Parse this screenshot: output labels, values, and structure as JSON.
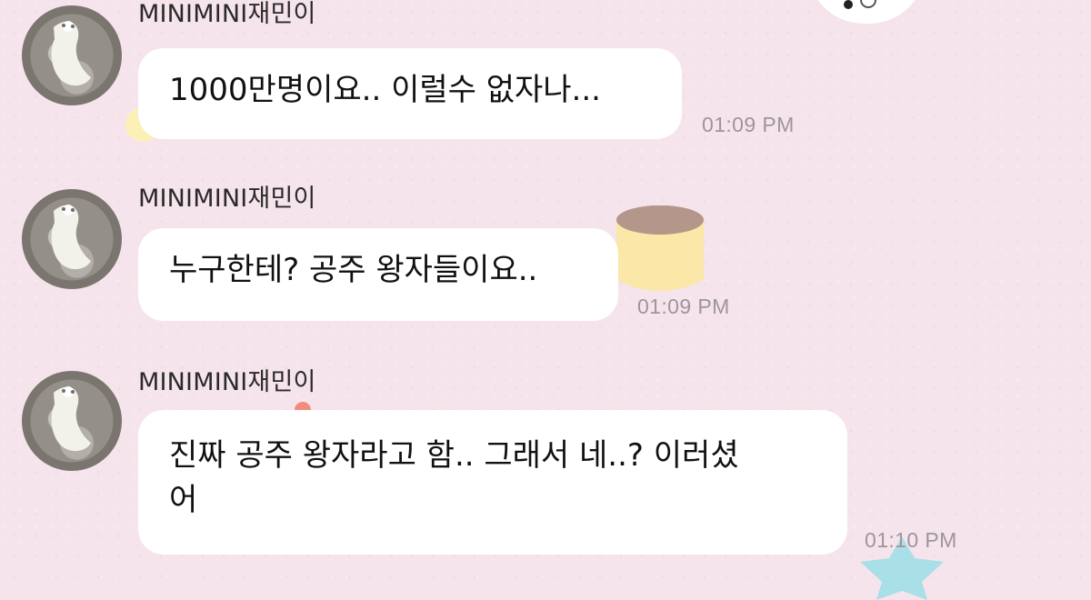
{
  "chat": {
    "messages": [
      {
        "sender": "MINIMINI재민이",
        "text": "1000만명이요.. 이럴수 없자나...",
        "time": "01:09 PM"
      },
      {
        "sender": "MINIMINI재민이",
        "text": "누구한테? 공주 왕자들이요..",
        "time": "01:09 PM"
      },
      {
        "sender": "MINIMINI재민이",
        "text": "진짜 공주 왕자라고 함.. 그래서 네..? 이러셨\n어",
        "time": "01:10 PM"
      }
    ]
  },
  "icons": {
    "avatar": "white-cat-avatar",
    "sticker_ghost": "ghost-sticker-icon",
    "sticker_cup": "cup-sticker-icon",
    "sticker_star": "star-sticker-icon",
    "sticker_blob": "blob-sticker-icon",
    "sticker_flower": "flower-sticker-icon"
  },
  "colors": {
    "background": "#f6e4ec",
    "bubble": "#ffffff",
    "timestamp": "#9d969c"
  }
}
